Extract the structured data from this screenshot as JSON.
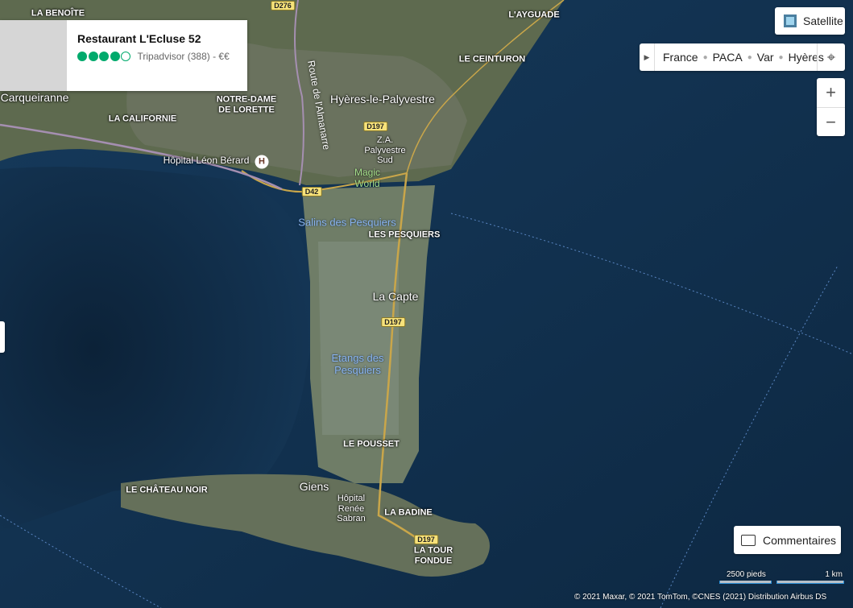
{
  "card": {
    "title": "Restaurant L'Ecluse 52",
    "rating_value": 4,
    "rating_max": 5,
    "rating_text": "Tripadvisor (388) - €€"
  },
  "controls": {
    "satellite_label": "Satellite",
    "breadcrumb": [
      "France",
      "PACA",
      "Var",
      "Hyères"
    ],
    "zoom_in": "+",
    "zoom_out": "−",
    "feedback_label": "Commentaires"
  },
  "scale": {
    "feet": "2500 pieds",
    "km": "1 km"
  },
  "copyright": "© 2021 Maxar, © 2021 TomTom, ©CNES (2021) Distribution Airbus DS",
  "labels": {
    "la_benoite": "LA BENOÎTE",
    "l_ayguade": "L'AYGUADE",
    "le_ceinturon": "LE CEINTURON",
    "carqueiranne": "Carqueiranne",
    "notre_dame": "NOTRE-DAME\nDE LORETTE",
    "la_californie": "LA CALIFORNIE",
    "hyeres_palyvestre": "Hyères-le-Palyvestre",
    "route_almanarre": "Route de l'Almanarre",
    "hopital_leon_berard": "Hôpital Léon Bérard",
    "za_palyvestre": "Z.A.\nPalyvestre\nSud",
    "magic_world": "Magic\nWorld",
    "salins_pesquiers": "Salins des Pesquiers",
    "les_pesquiers": "LES PESQUIERS",
    "la_capte": "La Capte",
    "etangs_pesquiers": "Etangs des\nPesquiers",
    "le_pousset": "LE POUSSET",
    "le_chateau_noir": "LE CHÂTEAU NOIR",
    "giens": "Giens",
    "hopital_renee_sabran": "Hôpital\nRenée\nSabran",
    "la_badine": "LA BADINE",
    "la_tour_fondue": "LA TOUR\nFONDUE",
    "hospital_glyph": "H"
  },
  "roads": {
    "d276": "D276",
    "d197_a": "D197",
    "d42": "D42",
    "d197_b": "D197",
    "d197_c": "D197"
  },
  "colors": {
    "sea": "#102d47",
    "land": "#5c6a4e",
    "salt_flats": "#7c8a76",
    "road": "#c9a64a",
    "tripadvisor_green": "#00aa6c"
  }
}
